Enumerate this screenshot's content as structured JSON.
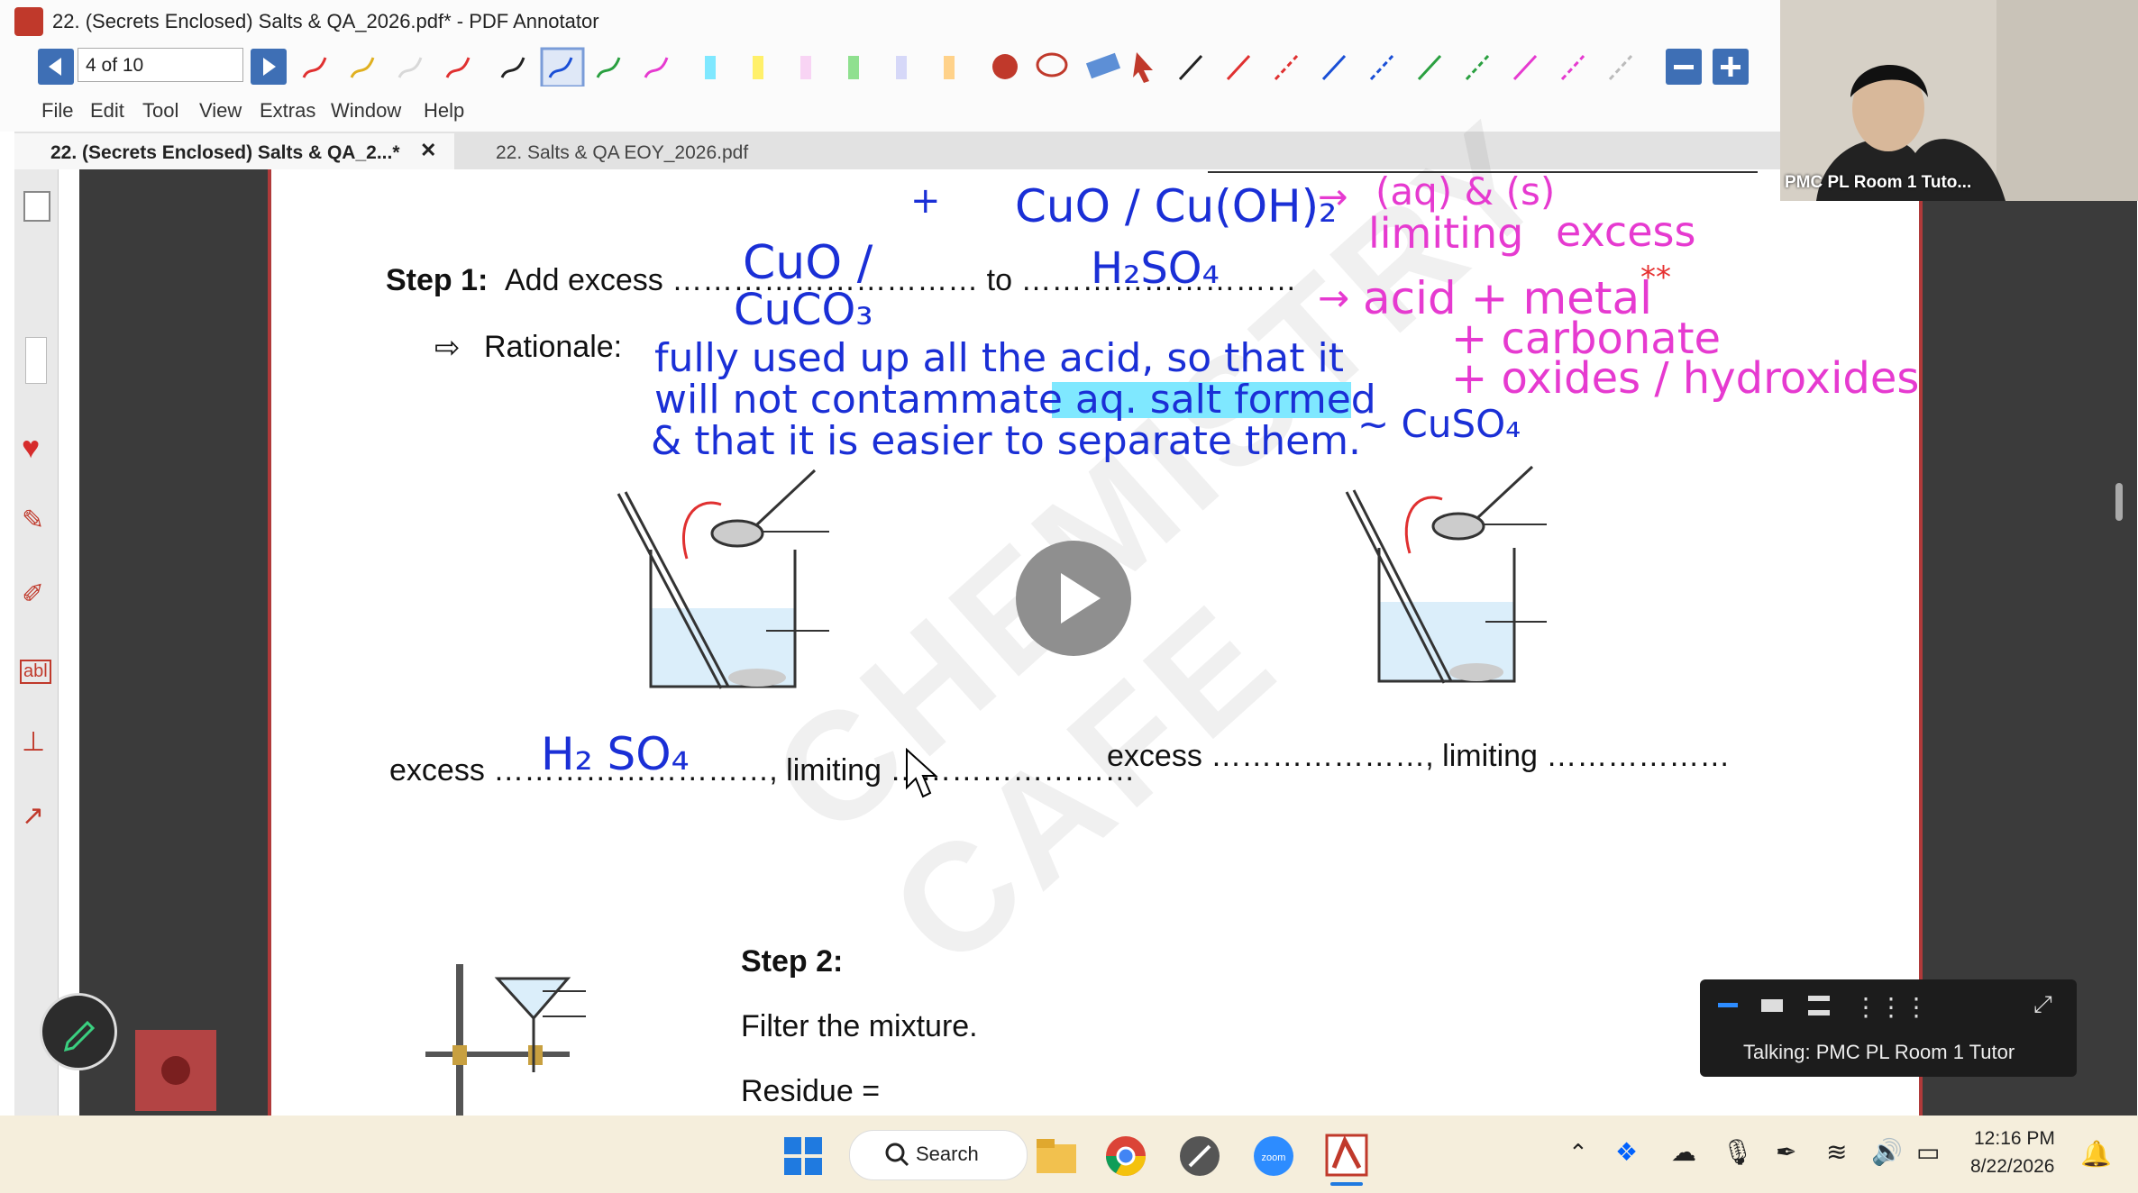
{
  "window": {
    "title": "22. (Secrets Enclosed) Salts & QA_2026.pdf* - PDF Annotator"
  },
  "toolbar": {
    "page_indicator": "4 of 10"
  },
  "menu": [
    "File",
    "Edit",
    "Tool",
    "View",
    "Extras",
    "Window",
    "Help"
  ],
  "tabs": [
    {
      "label": "22. (Secrets Enclosed) Salts & QA_2...*",
      "active": true
    },
    {
      "label": "22. Salts & QA EOY_2026.pdf",
      "active": false
    }
  ],
  "document": {
    "step1_label": "Step 1:",
    "step1_text": "Add excess ………………………… to ………………………",
    "rationale_label": "Rationale:",
    "excess_left": "excess ………………………, limiting ……………………",
    "excess_right": "excess …………………, limiting ………………",
    "step2_label": "Step 2:",
    "filter_text": "Filter the mixture.",
    "residue_text": "Residue ="
  },
  "handwriting": {
    "top_left_plus": "+",
    "top_formula": "CuO / Cu(OH)₂",
    "arrow_top": "→",
    "aq_s": "(aq)    &    (s)",
    "limiting": "limiting",
    "excess": "excess",
    "blank1": "CuO /",
    "blank1b": "CuCO₃",
    "blank2": "H₂SO₄",
    "arrow_acid": "→",
    "acid_line": "acid  +  metal",
    "stars": "**",
    "carbonate_line": "+  carbonate",
    "oxides_line": "+  oxides / hydroxides",
    "rationale_line1": "fully used up all the acid, so that it",
    "rationale_line2": "will not contammate aq. salt formed",
    "rationale_line3": "& that it is easier to separate them.",
    "cuso4": "~ CuSO₄",
    "excess_h2so4": "H₂ SO₄"
  },
  "video": {
    "participant_label": "PMC PL Room 1 Tuto..."
  },
  "zoom_panel": {
    "talking": "Talking: PMC PL Room 1 Tutor"
  },
  "taskbar": {
    "search": "Search",
    "time": "12:16 PM",
    "date": "8/22/2026"
  }
}
